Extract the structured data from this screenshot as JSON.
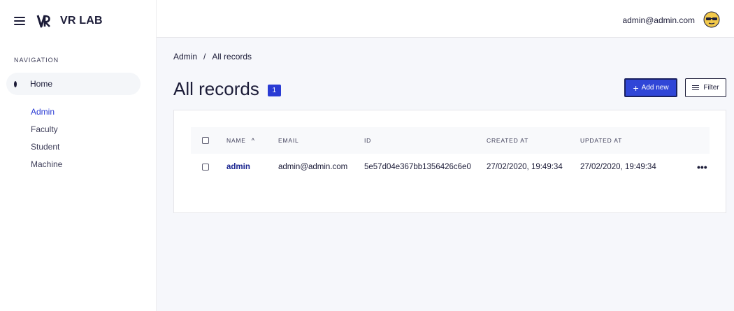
{
  "app": {
    "name": "VR LAB"
  },
  "topbar": {
    "user_email": "admin@admin.com"
  },
  "sidebar": {
    "nav_title": "NAVIGATION",
    "home_label": "Home",
    "items": [
      {
        "label": "Admin",
        "active": true
      },
      {
        "label": "Faculty",
        "active": false
      },
      {
        "label": "Student",
        "active": false
      },
      {
        "label": "Machine",
        "active": false
      }
    ]
  },
  "breadcrumb": {
    "root": "Admin",
    "separator": "/",
    "current": "All records"
  },
  "page": {
    "title": "All records",
    "count": "1"
  },
  "actions": {
    "add_label": "Add new",
    "filter_label": "Filter"
  },
  "table": {
    "columns": [
      "NAME",
      "EMAIL",
      "ID",
      "CREATED AT",
      "UPDATED AT"
    ],
    "sorted_column": "NAME",
    "sort_direction": "ascending",
    "rows": [
      {
        "name": "admin",
        "email": "admin@admin.com",
        "id": "5e57d04e367bb1356426c6e0",
        "created_at": "27/02/2020, 19:49:34",
        "updated_at": "27/02/2020, 19:49:34"
      }
    ]
  },
  "colors": {
    "accent": "#2a3bd4",
    "primary_button": "#3046d7",
    "text": "#1c1c38",
    "background": "#f6f7fb"
  }
}
